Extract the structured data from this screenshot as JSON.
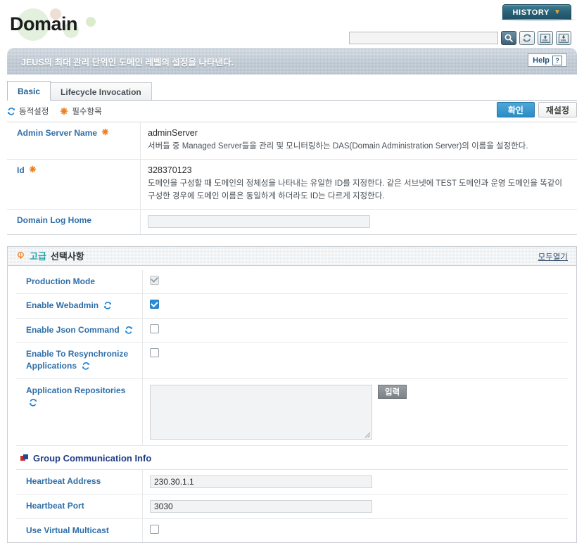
{
  "header": {
    "logo_text": "Domain",
    "history_label": "HISTORY",
    "history_icon": "chevron-down-icon",
    "search_value": "",
    "search_placeholder": "",
    "buttons": [
      {
        "name": "search-icon",
        "label": "search"
      },
      {
        "name": "refresh-icon",
        "label": "refresh"
      },
      {
        "name": "xml-import-icon",
        "label": "XML"
      },
      {
        "name": "xml-export-icon",
        "label": "XML"
      }
    ]
  },
  "banner": {
    "text": "JEUS의 최대 관리 단위인 도메인 레벨의 설정을 나타낸다.",
    "help_label": "Help",
    "help_icon": "question-mark-icon"
  },
  "tabs": [
    {
      "label": "Basic",
      "active": true
    },
    {
      "label": "Lifecycle Invocation",
      "active": false
    }
  ],
  "legend": [
    {
      "icon": "sync-icon",
      "label": "동적설정"
    },
    {
      "icon": "asterisk-icon",
      "label": "필수항목"
    }
  ],
  "actions": {
    "confirm_label": "확인",
    "reset_label": "재설정"
  },
  "basic_rows": [
    {
      "label": "Admin Server Name",
      "required": true,
      "dynamic": false,
      "value": "adminServer",
      "description": "서버들 중 Managed Server들을 관리 및 모니터링하는 DAS(Domain Administration Server)의 이름을 설정한다."
    },
    {
      "label": "Id",
      "required": true,
      "dynamic": false,
      "value": "328370123",
      "description": "도메인을 구성할 때 도메인의 정체성을 나타내는 유일한 ID를 지정한다. 같은 서브넷에 TEST 도메인과 운영 도메인을 똑같이 구성한 경우에 도메인 이름은 동일하게 하더라도 ID는 다르게 지정한다."
    },
    {
      "label": "Domain Log Home",
      "required": false,
      "dynamic": false,
      "input_value": "",
      "description": ""
    }
  ],
  "advanced": {
    "title_highlight": "고급",
    "title_rest": "선택사항",
    "title_icon": "info-bulb-icon",
    "expand_all_label": "모두열기",
    "rows": [
      {
        "label": "Production Mode",
        "dynamic": false,
        "type": "checkbox",
        "checked": true,
        "disabled": true
      },
      {
        "label": "Enable Webadmin",
        "dynamic": true,
        "type": "checkbox",
        "checked": true,
        "disabled": false
      },
      {
        "label": "Enable Json Command",
        "dynamic": true,
        "type": "checkbox",
        "checked": false,
        "disabled": false
      },
      {
        "label": "Enable To Resynchronize Applications",
        "dynamic": true,
        "type": "checkbox",
        "checked": false,
        "disabled": false
      },
      {
        "label": "Application Repositories",
        "dynamic": true,
        "type": "textarea",
        "value": "",
        "button_label": "입력"
      }
    ],
    "group_section": {
      "title": "Group Communication Info",
      "icon": "square-marker-icon",
      "rows": [
        {
          "label": "Heartbeat Address",
          "type": "text",
          "value": "230.30.1.1"
        },
        {
          "label": "Heartbeat Port",
          "type": "text",
          "value": "3030"
        },
        {
          "label": "Use Virtual Multicast",
          "type": "checkbox",
          "checked": false,
          "disabled": false
        }
      ]
    }
  },
  "colors": {
    "label_blue": "#2e6ea8",
    "accent_teal": "#22a3ac",
    "required_orange": "#ef7d1a",
    "primary_button": "#2b8cc4",
    "heading_navy": "#1f3d84"
  }
}
